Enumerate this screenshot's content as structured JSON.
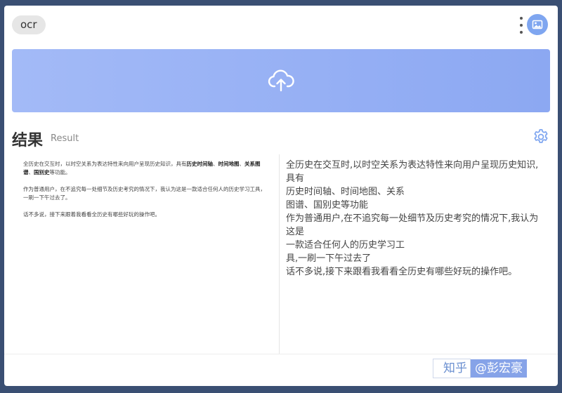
{
  "header": {
    "app_chip": "ocr"
  },
  "result": {
    "title": "结果",
    "subtitle": "Result"
  },
  "document": {
    "p1_pre": "全历史在交互时，以时空关系为表达特性来向用户呈现历史知识，具有",
    "p1_b1": "历史时间轴",
    "p1_s1": "、",
    "p1_b2": "时间地图",
    "p1_s2": "、",
    "p1_b3": "关系图谱",
    "p1_s3": "、",
    "p1_b4": "国别史",
    "p1_post": "等功能。",
    "p2": "作为普通用户，在不追究每一处细节及历史考究的情况下，我认为这是一款适合任何人的历史学习工具，一刷一下午过去了。",
    "p3": "话不多说，接下来跟着我看看全历史有哪些好玩的操作吧。"
  },
  "ocr_output": {
    "lines": [
      "全历史在交互时,以时空关系为表达特性来向用户呈现历史知识,具有",
      "历史时间轴、时间地图、关系",
      "图谱、国别史等功能",
      "作为普通用户,在不追究每一处细节及历史考究的情况下,我认为这是",
      "一款适合任何人的历史学习工",
      "具,一刷一下午过去了",
      "话不多说,接下来跟看我看看全历史有哪些好玩的操作吧。"
    ]
  },
  "watermark": {
    "site": "知乎",
    "user": "@彭宏豪"
  },
  "icons": {
    "menu": "more-vertical-icon",
    "avatar": "image-icon",
    "upload": "cloud-upload-icon",
    "settings": "gear-icon"
  },
  "colors": {
    "accent": "#8ca8f2",
    "avatar_bg": "#7fa6f0",
    "settings": "#7fa6f0"
  }
}
